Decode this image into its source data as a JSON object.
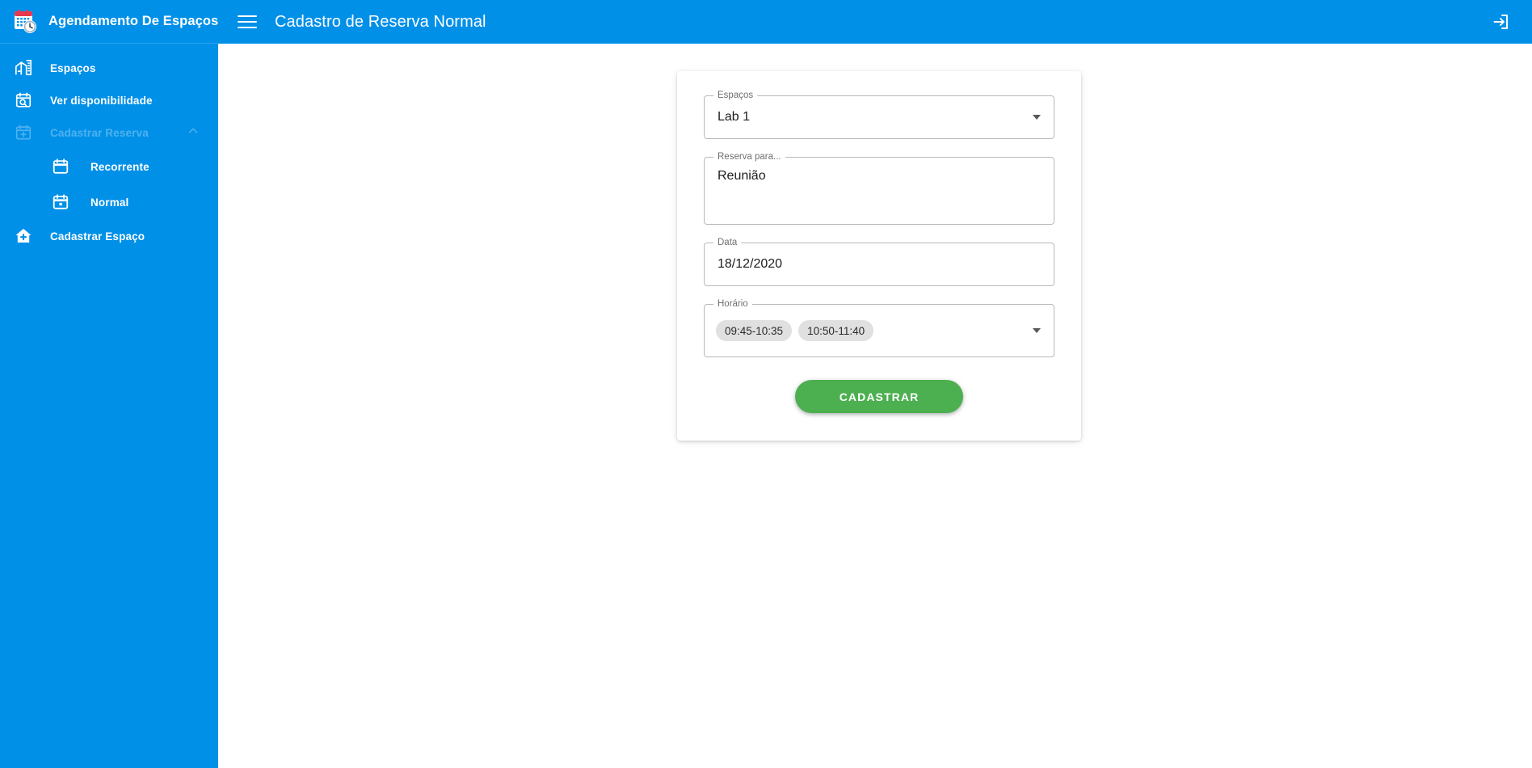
{
  "colors": {
    "primary_blue": "#0090e8",
    "submit_green": "#4caf50",
    "chip_grey": "#e0e0e0",
    "page_background": "#ffffff"
  },
  "sidebar": {
    "brand_title": "Agendamento De Espaços",
    "brand_logo_icon": "calendar-clock-icon",
    "items": [
      {
        "label": "Espaços",
        "icon": "building-home-icon",
        "type": "link"
      },
      {
        "label": "Ver disponibilidade",
        "icon": "calendar-search-icon",
        "type": "link"
      },
      {
        "label": "Cadastrar Reserva",
        "icon": "calendar-plus-icon",
        "type": "group",
        "expanded": true,
        "chevron": "chevron-up-icon",
        "disabled": true
      },
      {
        "label": "Recorrente",
        "icon": "calendar-icon",
        "type": "sub"
      },
      {
        "label": "Normal",
        "icon": "calendar-event-icon",
        "type": "sub"
      },
      {
        "label": "Cadastrar Espaço",
        "icon": "home-plus-icon",
        "type": "link"
      }
    ]
  },
  "topbar": {
    "menu_icon": "hamburger-menu-icon",
    "title": "Cadastro de Reserva Normal",
    "logout_icon": "logout-icon"
  },
  "form": {
    "espacos": {
      "label": "Espaços",
      "value": "Lab 1",
      "dropdown_icon": "chevron-down-icon"
    },
    "reserva_para": {
      "label": "Reserva para...",
      "value": "Reunião"
    },
    "data": {
      "label": "Data",
      "value": "18/12/2020"
    },
    "horario": {
      "label": "Horário",
      "dropdown_icon": "chevron-down-icon",
      "chips": [
        "09:45-10:35",
        "10:50-11:40"
      ]
    },
    "submit_label": "CADASTRAR"
  }
}
